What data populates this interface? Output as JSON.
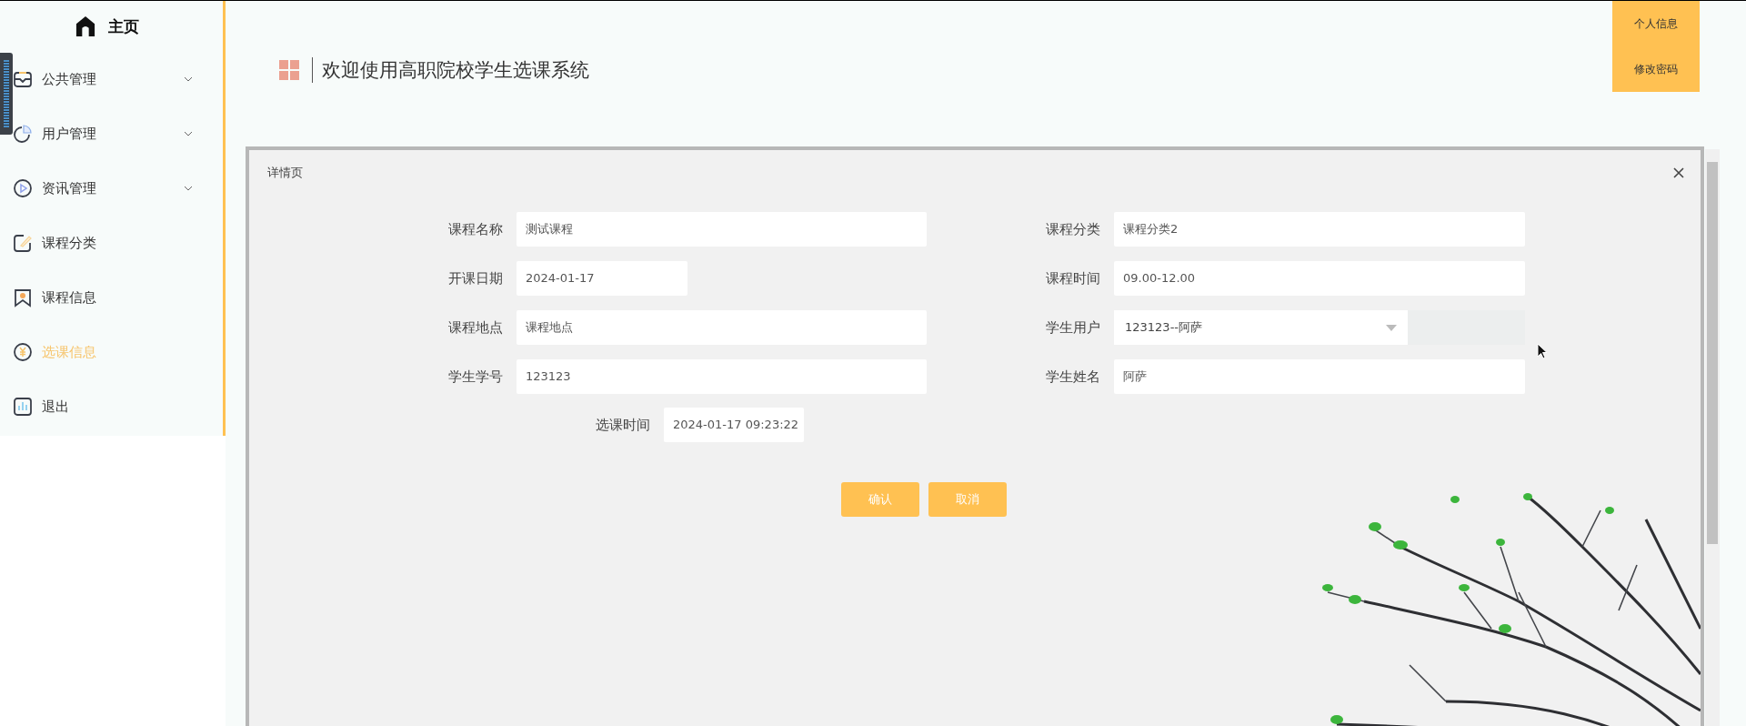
{
  "sidebar": {
    "home": {
      "label": "主页"
    },
    "items": [
      {
        "label": "公共管理",
        "expandable": true,
        "selected": false
      },
      {
        "label": "用户管理",
        "expandable": true,
        "selected": false
      },
      {
        "label": "资讯管理",
        "expandable": true,
        "selected": false
      },
      {
        "label": "课程分类",
        "expandable": false,
        "selected": false
      },
      {
        "label": "课程信息",
        "expandable": false,
        "selected": false
      },
      {
        "label": "选课信息",
        "expandable": false,
        "selected": true
      },
      {
        "label": "退出",
        "expandable": false,
        "selected": false
      }
    ]
  },
  "header": {
    "title": "欢迎使用高职院校学生选课系统"
  },
  "user_menu": [
    "个人信息",
    "修改密码"
  ],
  "dialog": {
    "title": "详情页",
    "fields": [
      {
        "label": "课程名称",
        "value": "测试课程",
        "kind": "text"
      },
      {
        "label": "课程分类",
        "value": "课程分类2",
        "kind": "text"
      },
      {
        "label": "开课日期",
        "value": "2024-01-17",
        "kind": "date"
      },
      {
        "label": "课程时间",
        "value": "09.00-12.00",
        "kind": "text"
      },
      {
        "label": "课程地点",
        "value": "课程地点",
        "kind": "text"
      },
      {
        "label": "学生用户",
        "value": "123123--阿萨",
        "kind": "select"
      },
      {
        "label": "学生学号",
        "value": "123123",
        "kind": "text"
      },
      {
        "label": "学生姓名",
        "value": "阿萨",
        "kind": "text"
      }
    ],
    "time_field": {
      "label": "选课时间",
      "value": "2024-01-17 09:23:22"
    },
    "buttons": [
      "确认",
      "取消"
    ]
  }
}
